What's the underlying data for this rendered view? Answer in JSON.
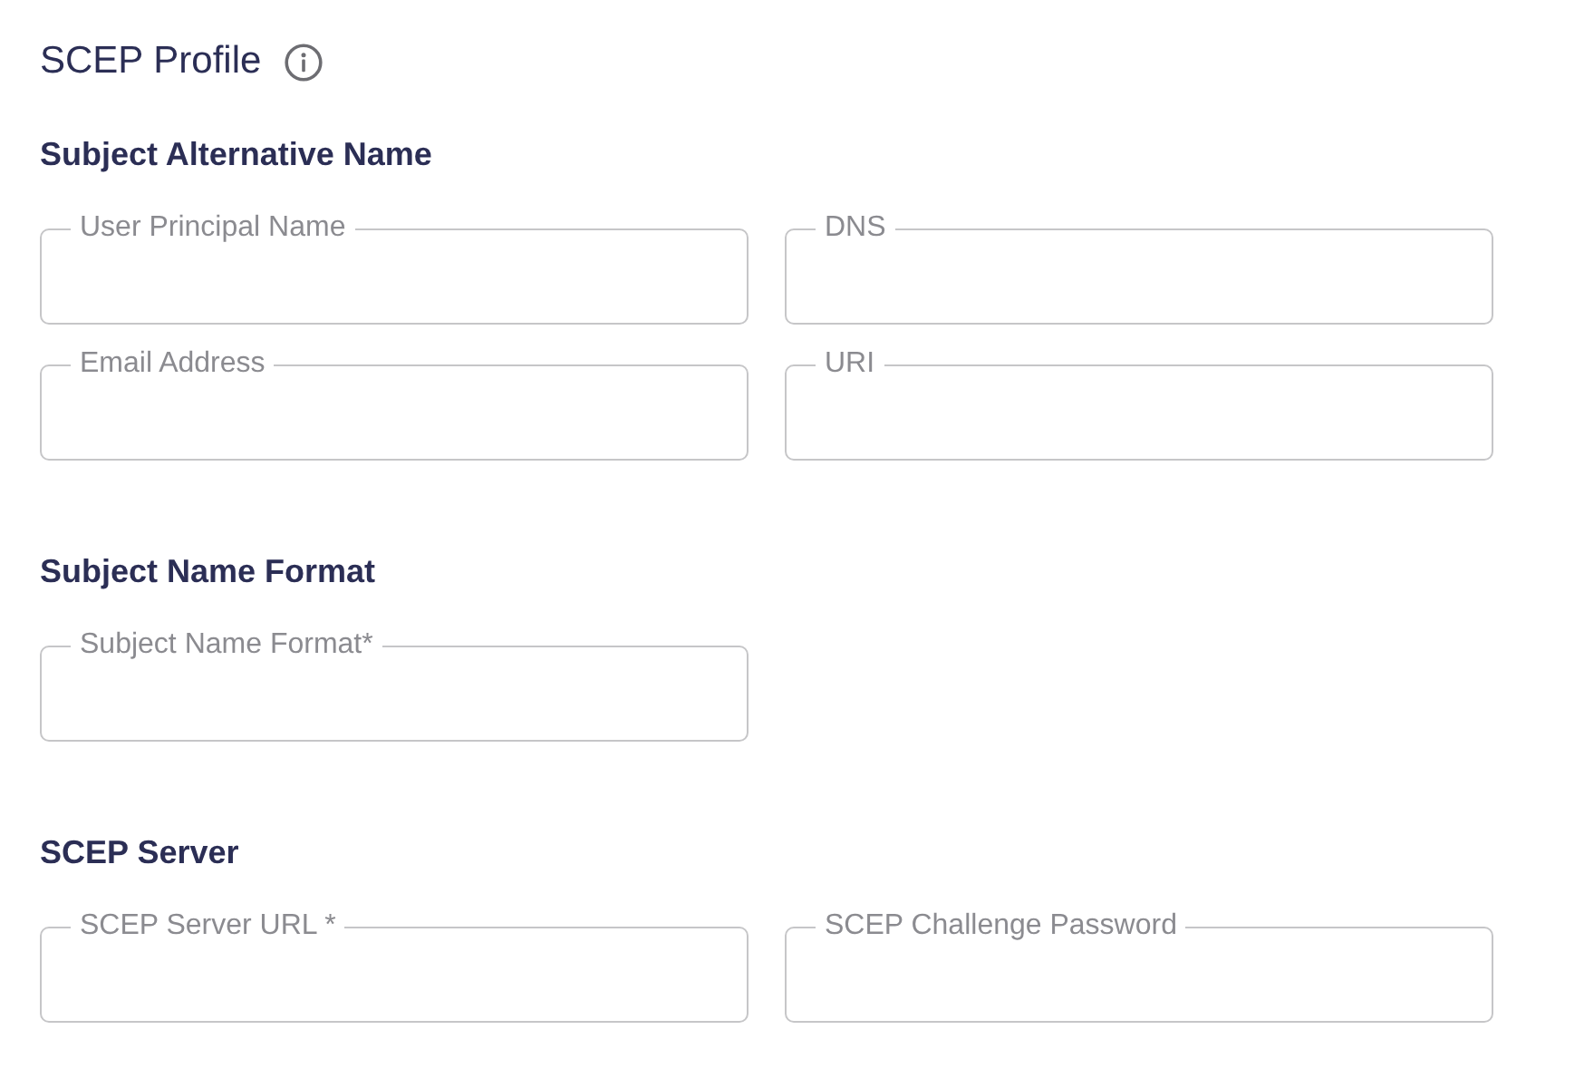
{
  "page": {
    "title": "SCEP Profile"
  },
  "sections": [
    {
      "heading": "Subject Alternative Name",
      "fields": [
        {
          "label": "User Principal Name"
        },
        {
          "label": "DNS"
        },
        {
          "label": "Email Address"
        },
        {
          "label": "URI"
        }
      ]
    },
    {
      "heading": "Subject Name Format",
      "fields": [
        {
          "label": "Subject Name Format*"
        }
      ]
    },
    {
      "heading": "SCEP Server",
      "fields": [
        {
          "label": "SCEP Server URL *"
        },
        {
          "label": "SCEP Challenge Password"
        }
      ]
    }
  ]
}
